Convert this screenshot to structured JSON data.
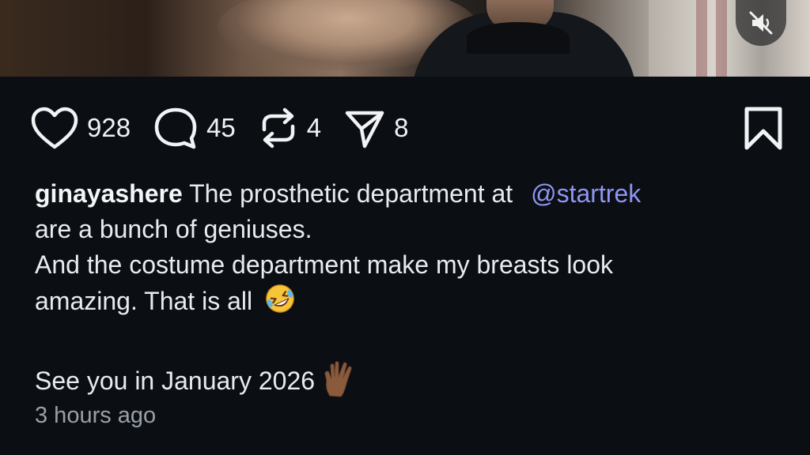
{
  "media": {
    "mute_icon": "speaker-muted-icon"
  },
  "actions": {
    "like": {
      "icon": "heart-icon",
      "count": "928"
    },
    "comment": {
      "icon": "comment-bubble-icon",
      "count": "45"
    },
    "repost": {
      "icon": "repost-icon",
      "count": "4"
    },
    "share": {
      "icon": "send-icon",
      "count": "8"
    },
    "bookmark": {
      "icon": "bookmark-icon"
    }
  },
  "post": {
    "username": "ginayashere",
    "line1": "The prosthetic department at",
    "mention": "@startrek",
    "line2": "are a bunch of geniuses.",
    "line3": "And the costume department make my breasts look",
    "line4": "amazing. That is all",
    "line5": "See you in January 2026",
    "emoji1": "rolling-on-floor-laughing-emoji",
    "emoji2": "vulcan-salute-emoji",
    "timestamp": "3 hours ago"
  },
  "colors": {
    "background": "#0b0f14",
    "text": "#ebedf0",
    "mention": "#8f95f3",
    "muted": "#9aa0a8"
  }
}
